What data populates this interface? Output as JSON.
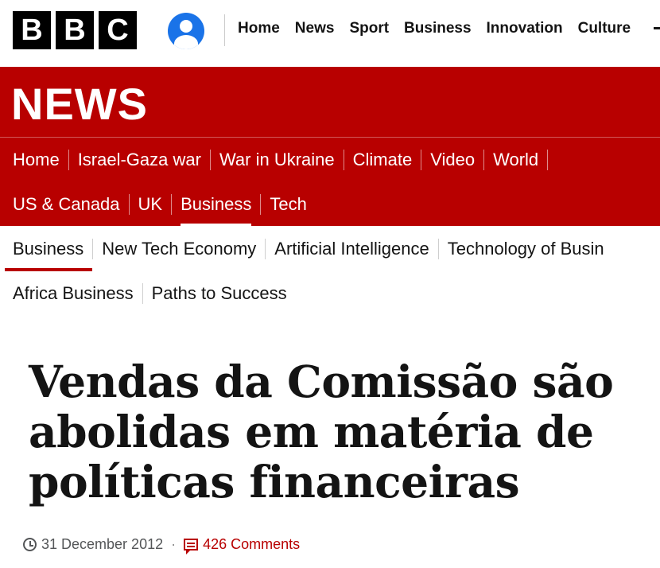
{
  "brand": {
    "logo_letters": [
      "B",
      "B",
      "C"
    ]
  },
  "top_nav": {
    "items": [
      "Home",
      "News",
      "Sport",
      "Business",
      "Innovation",
      "Culture"
    ]
  },
  "news_header": {
    "title": "NEWS"
  },
  "section_nav": {
    "row1": [
      "Home",
      "Israel-Gaza war",
      "War in Ukraine",
      "Climate",
      "Video",
      "World"
    ],
    "row2": [
      "US & Canada",
      "UK",
      "Business",
      "Tech"
    ],
    "active": "Business"
  },
  "sub_nav": {
    "row1": [
      "Business",
      "New Tech Economy",
      "Artificial Intelligence",
      "Technology of Busin"
    ],
    "row2": [
      "Africa Business",
      "Paths to Success"
    ],
    "active": "Business"
  },
  "article": {
    "headline_lines": [
      "Vendas da Comissão são",
      "abolidas em matéria de",
      "políticas financeiras"
    ],
    "date": "31 December 2012",
    "separator": "·",
    "comments": "426 Comments"
  },
  "colors": {
    "brand_red": "#b80000",
    "text": "#141414",
    "account_blue": "#1a73e8"
  }
}
